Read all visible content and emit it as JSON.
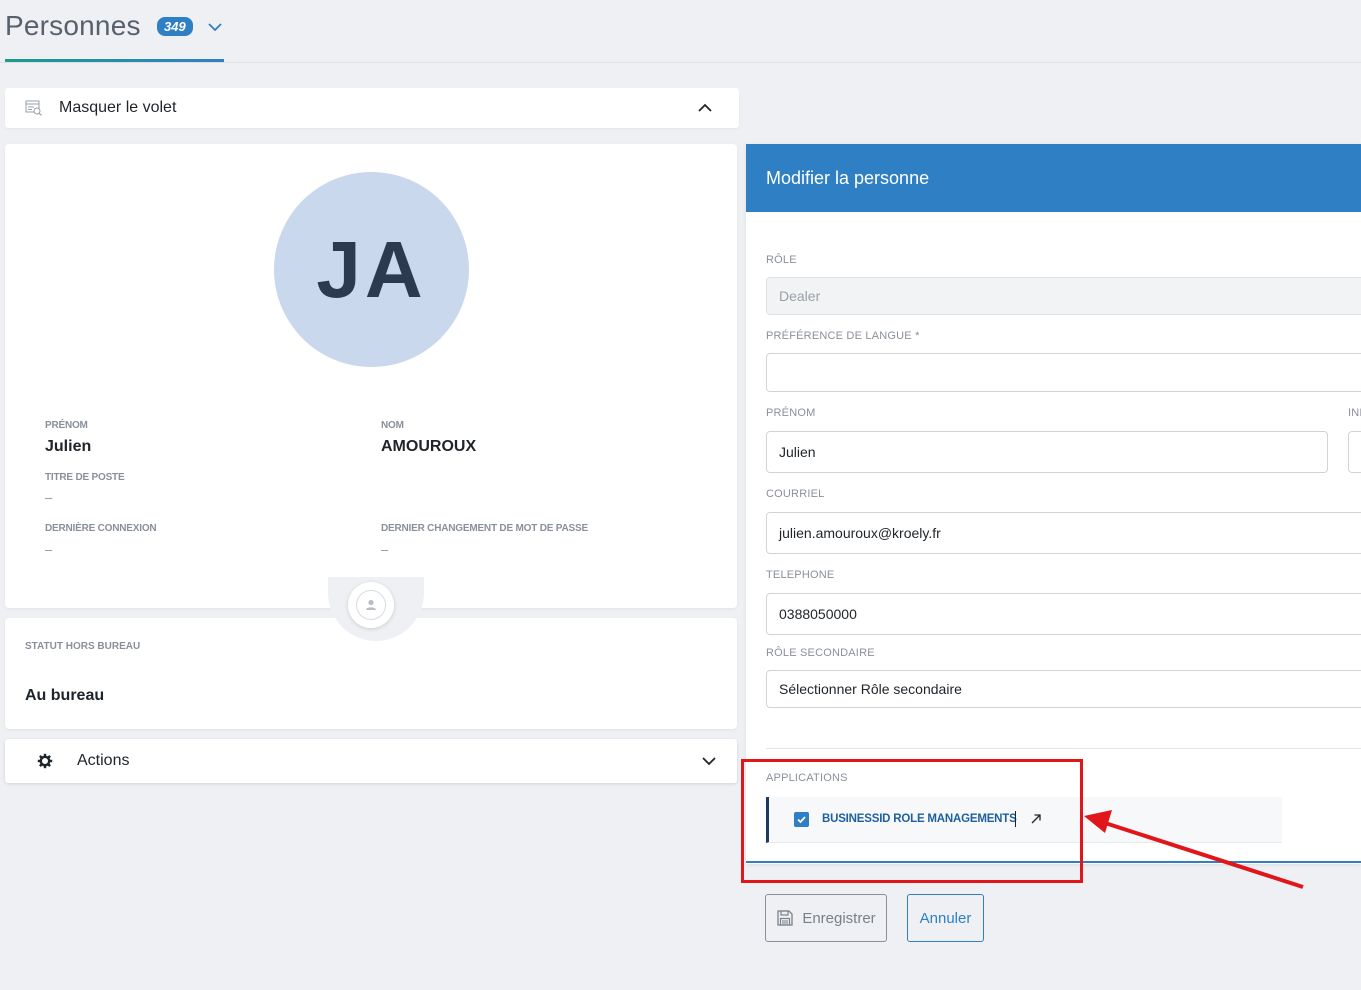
{
  "header": {
    "title": "Personnes",
    "count": "349"
  },
  "panel_toggle": {
    "label": "Masquer le volet"
  },
  "profile": {
    "initials": "JA",
    "fields": {
      "prenom_label": "PRÉNOM",
      "prenom_value": "Julien",
      "nom_label": "NOM",
      "nom_value": "AMOUROUX",
      "titre_label": "TITRE DE POSTE",
      "titre_value": "–",
      "connexion_label": "DERNIÈRE CONNEXION",
      "connexion_value": "–",
      "mdp_label": "DERNIER CHANGEMENT DE MOT DE PASSE",
      "mdp_value": "–"
    },
    "status_label": "STATUT HORS BUREAU",
    "status_value": "Au bureau"
  },
  "actions": {
    "label": "Actions"
  },
  "edit_form": {
    "title": "Modifier la personne",
    "role_label": "RÔLE",
    "role_value": "Dealer",
    "langue_label": "PRÉFÉRENCE DE LANGUE *",
    "langue_value": "",
    "prenom_label": "PRÉNOM",
    "prenom_value": "Julien",
    "cut_label": "INI",
    "courriel_label": "COURRIEL",
    "courriel_value": "julien.amouroux@kroely.fr",
    "telephone_label": "TELEPHONE",
    "telephone_value": "0388050000",
    "role_secondaire_label": "RÔLE SECONDAIRE",
    "role_secondaire_value": "Sélectionner Rôle secondaire",
    "applications_label": "APPLICATIONS",
    "applications": [
      {
        "label": "BUSINESSID ROLE MANAGEMENTS",
        "checked": true
      }
    ]
  },
  "buttons": {
    "save_label": "Enregistrer",
    "cancel_label": "Annuler"
  },
  "colors": {
    "primary": "#2f7fc4",
    "annotation": "#e0161b"
  }
}
